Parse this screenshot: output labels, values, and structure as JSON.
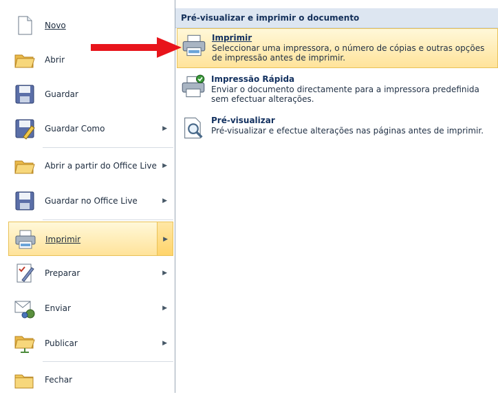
{
  "menu": {
    "items": [
      {
        "label": "Novo",
        "icon": "new-document-icon",
        "submenu": false
      },
      {
        "label": "Abrir",
        "icon": "open-folder-icon",
        "submenu": false
      },
      {
        "label": "Guardar",
        "icon": "save-disk-icon",
        "submenu": false
      },
      {
        "label": "Guardar Como",
        "icon": "save-as-icon",
        "submenu": true
      },
      {
        "label": "Abrir a partir do Office Live",
        "icon": "open-folder-icon",
        "submenu": true
      },
      {
        "label": "Guardar no Office Live",
        "icon": "save-disk-icon",
        "submenu": true
      },
      {
        "label": "Imprimir",
        "icon": "printer-icon",
        "submenu": true,
        "selected": true
      },
      {
        "label": "Preparar",
        "icon": "prepare-icon",
        "submenu": true
      },
      {
        "label": "Enviar",
        "icon": "send-icon",
        "submenu": true
      },
      {
        "label": "Publicar",
        "icon": "publish-icon",
        "submenu": true
      },
      {
        "label": "Fechar",
        "icon": "close-folder-icon",
        "submenu": false
      }
    ],
    "arrow_glyph": "▶"
  },
  "submenu": {
    "header": "Pré-visualizar e imprimir o documento",
    "options": [
      {
        "title": "Imprimir",
        "desc": "Seleccionar uma impressora, o número de cópias e outras opções de impressão antes de imprimir.",
        "icon": "printer-icon",
        "selected": true
      },
      {
        "title": "Impressão Rápida",
        "desc": "Enviar o documento directamente para a impressora predefinida sem efectuar alterações.",
        "icon": "quick-print-icon"
      },
      {
        "title": "Pré-visualizar",
        "desc": "Pré-visualizar e efectue alterações nas páginas antes de imprimir.",
        "icon": "print-preview-icon"
      }
    ]
  },
  "colors": {
    "highlight": "#ffe39a",
    "highlight_border": "#e9c157",
    "header_bg": "#dde6f1",
    "annotation_arrow": "#e8141b"
  }
}
